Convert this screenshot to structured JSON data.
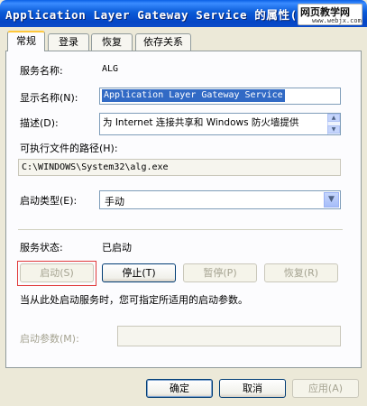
{
  "window": {
    "title": "Application Layer Gateway Service 的属性(",
    "watermark_main": "网页教学网",
    "watermark_sub": "www.webjx.com"
  },
  "tabs": [
    "常规",
    "登录",
    "恢复",
    "依存关系"
  ],
  "general": {
    "service_name_label": "服务名称:",
    "service_name_value": "ALG",
    "display_name_label": "显示名称(N):",
    "display_name_value": "Application Layer Gateway Service",
    "description_label": "描述(D):",
    "description_value": "为 Internet 连接共享和 Windows 防火墙提供",
    "exe_path_label": "可执行文件的路径(H):",
    "exe_path_value": "C:\\WINDOWS\\System32\\alg.exe",
    "startup_type_label": "启动类型(E):",
    "startup_type_value": "手动",
    "status_label": "服务状态:",
    "status_value": "已启动",
    "start_button": "启动(S)",
    "stop_button": "停止(T)",
    "pause_button": "暂停(P)",
    "resume_button": "恢复(R)",
    "hint": "当从此处启动服务时，您可指定所适用的启动参数。",
    "params_label": "启动参数(M):",
    "params_value": ""
  },
  "footer": {
    "ok": "确定",
    "cancel": "取消",
    "apply": "应用(A)"
  }
}
